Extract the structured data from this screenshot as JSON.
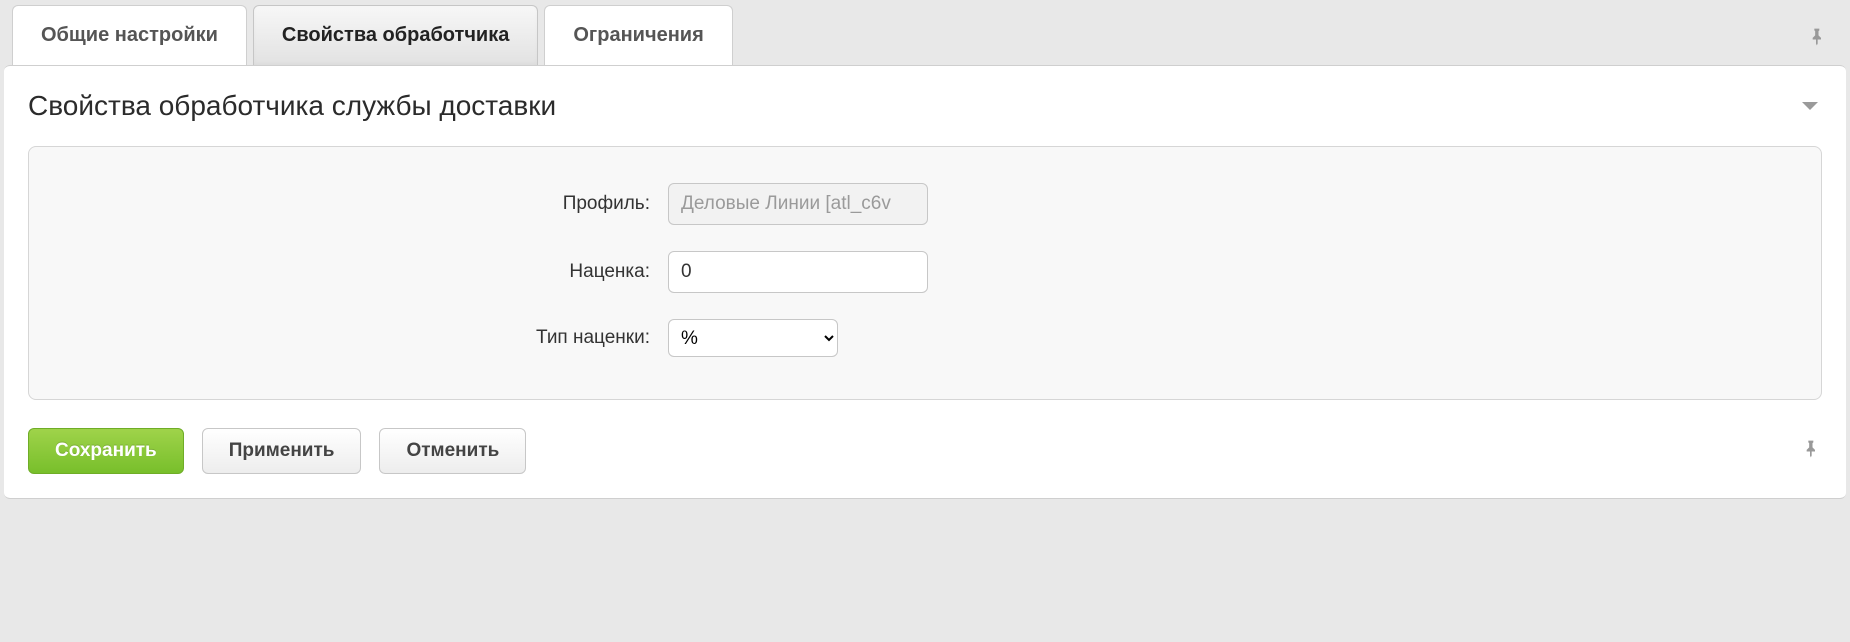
{
  "tabs": [
    {
      "label": "Общие настройки",
      "active": false
    },
    {
      "label": "Свойства обработчика",
      "active": true
    },
    {
      "label": "Ограничения",
      "active": false
    }
  ],
  "panel": {
    "title": "Свойства обработчика службы доставки"
  },
  "fields": {
    "profile_label": "Профиль:",
    "profile_value": "Деловые Линии [atl_c6v",
    "markup_label": "Наценка:",
    "markup_value": "0",
    "markup_type_label": "Тип наценки:",
    "markup_type_value": "%",
    "markup_type_options": [
      "%"
    ]
  },
  "buttons": {
    "save": "Сохранить",
    "apply": "Применить",
    "cancel": "Отменить"
  }
}
